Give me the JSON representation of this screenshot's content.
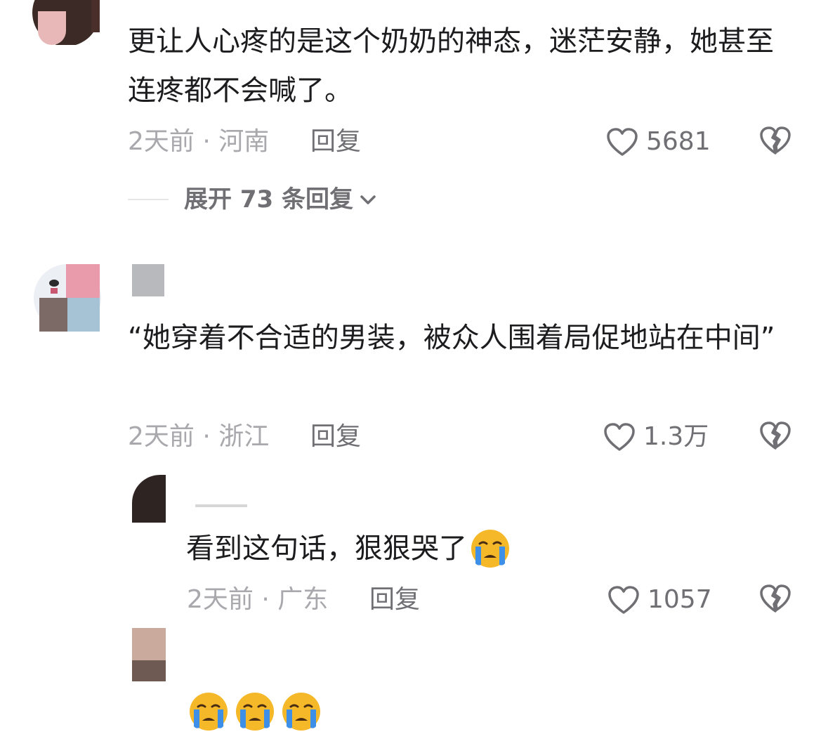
{
  "comments": [
    {
      "text": "更让人心疼的是这个奶奶的神态，迷茫安静，她甚至连疼都不会喊了。",
      "meta": "2天前 · 河南",
      "reply_label": "回复",
      "likes": "5681",
      "expand_label": "展开 73 条回复"
    },
    {
      "text": "“她穿着不合适的男装，被众人围着局促地站在中间”",
      "meta": "2天前 · 浙江",
      "reply_label": "回复",
      "likes": "1.3万",
      "replies": [
        {
          "text": "看到这句话，狠狠哭了",
          "meta": "2天前 · 广东",
          "reply_label": "回复",
          "likes": "1057",
          "emoji": "crying-face-icon"
        },
        {
          "emoji_count": 3,
          "emoji": "crying-face-icon"
        }
      ]
    }
  ],
  "colors": {
    "text": "#1c1c1e",
    "meta": "#a8a8ad",
    "secondary": "#6f6f74",
    "divider": "#e6e6e8",
    "emoji_face": "#f5b829",
    "emoji_tear": "#3d8fe8"
  }
}
